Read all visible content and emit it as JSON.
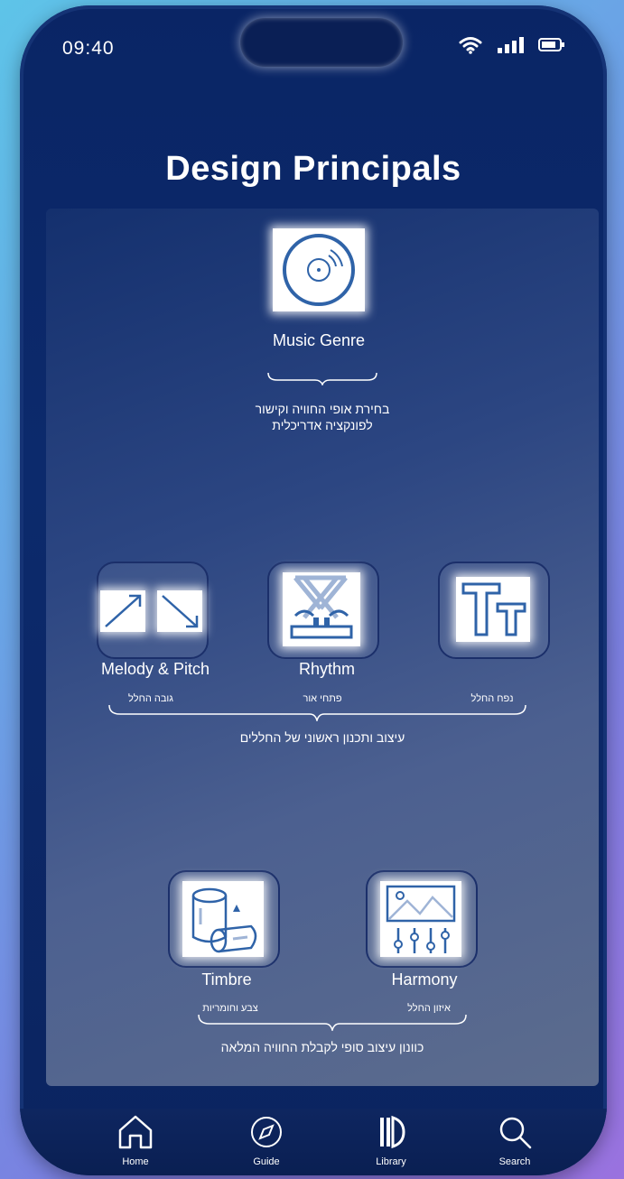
{
  "status_bar": {
    "time": "09:40"
  },
  "page": {
    "title": "Design Principals"
  },
  "sections": {
    "genre": {
      "label": "Music Genre",
      "desc_line1": "בחירת אופי החוויה וקישור",
      "desc_line2": "לפונקציה אדריכלית"
    },
    "row2": {
      "items": [
        {
          "label": "Melody & Pitch",
          "sub": "גובה החלל",
          "icon": "diagonal-arrows-icon"
        },
        {
          "label": "Rhythm",
          "sub": "פתחי אור",
          "icon": "rhythm-structure-icon"
        },
        {
          "label": "",
          "sub": "נפח החלל",
          "icon": "text-size-icon"
        }
      ],
      "desc": "עיצוב ותכנון ראשוני של החללים"
    },
    "row3": {
      "items": [
        {
          "label": "Timbre",
          "sub": "צבע וחומריות",
          "icon": "materials-icon"
        },
        {
          "label": "Harmony",
          "sub": "איזון החלל",
          "icon": "landscape-equalizer-icon"
        }
      ],
      "desc": "כוונון עיצוב סופי לקבלת החוויה המלאה"
    }
  },
  "nav": [
    {
      "label": "Home",
      "icon": "home-icon"
    },
    {
      "label": "Guide",
      "icon": "compass-icon"
    },
    {
      "label": "Library",
      "icon": "library-icon"
    },
    {
      "label": "Search",
      "icon": "search-icon"
    }
  ],
  "colors": {
    "accent": "#2f63a8",
    "phone_bg": "#0b2563"
  }
}
